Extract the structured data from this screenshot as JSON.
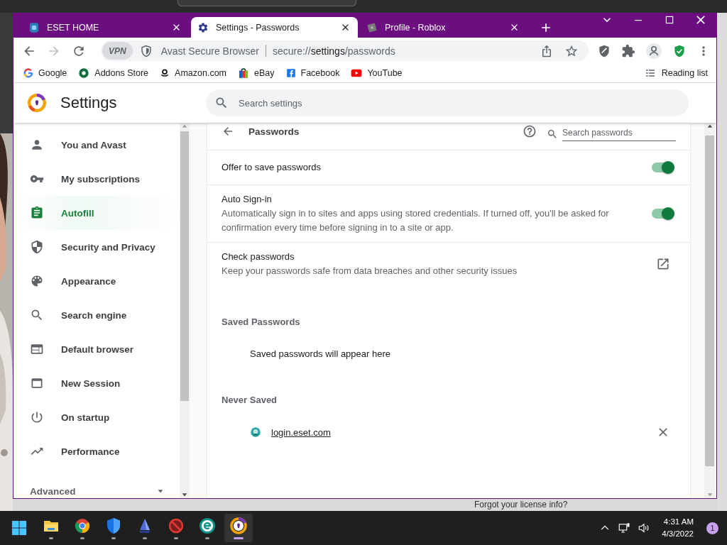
{
  "desktop": {
    "background_text": "Forgot your license info?"
  },
  "browser": {
    "tabs": [
      {
        "title": "ESET HOME",
        "selected": false
      },
      {
        "title": "Settings - Passwords",
        "selected": true
      },
      {
        "title": "Profile - Roblox",
        "selected": false
      }
    ],
    "toolbar": {
      "forward_disabled": true,
      "vpn": "VPN",
      "browser_name": "Avast Secure Browser",
      "url": "secure://**settings**/passwords"
    },
    "bookmarks": [
      "Google",
      "Addons Store",
      "Amazon.com",
      "eBay",
      "Facebook",
      "YouTube"
    ],
    "reading_list": "Reading list"
  },
  "settings": {
    "title": "Settings",
    "search_placeholder": "Search settings",
    "sidebar": {
      "items": [
        {
          "label": "You and Avast",
          "selected": false
        },
        {
          "label": "My subscriptions",
          "selected": false
        },
        {
          "label": "Autofill",
          "selected": true
        },
        {
          "label": "Security and Privacy",
          "selected": false
        },
        {
          "label": "Appearance",
          "selected": false
        },
        {
          "label": "Search engine",
          "selected": false
        },
        {
          "label": "Default browser",
          "selected": false
        },
        {
          "label": "New Session",
          "selected": false
        },
        {
          "label": "On startup",
          "selected": false
        },
        {
          "label": "Performance",
          "selected": false
        }
      ],
      "advanced": "Advanced"
    },
    "passwords": {
      "title": "Passwords",
      "search_placeholder": "Search passwords",
      "rows": [
        {
          "kind": "toggle",
          "title": "Offer to save passwords",
          "on": true
        },
        {
          "kind": "toggle",
          "title": "Auto Sign-in",
          "description": "Automatically sign in to sites and apps using stored credentials. If turned off, you'll be asked for confirmation every time before signing in to a site or app.",
          "on": true
        },
        {
          "kind": "link",
          "title": "Check passwords",
          "description": "Keep your passwords safe from data breaches and other security issues"
        }
      ],
      "saved": {
        "heading": "Saved Passwords",
        "empty_text": "Saved passwords will appear here"
      },
      "never_saved": {
        "heading": "Never Saved",
        "sites": [
          "login.eset.com"
        ]
      }
    }
  },
  "taskbar": {
    "apps": [
      {
        "active": false
      },
      {
        "active": false
      },
      {
        "active": false
      },
      {
        "active": false
      },
      {
        "active": false
      },
      {
        "active": false
      },
      {
        "active": true
      }
    ],
    "time": "4:31 AM",
    "date": "4/3/2022",
    "notifications": "1"
  }
}
